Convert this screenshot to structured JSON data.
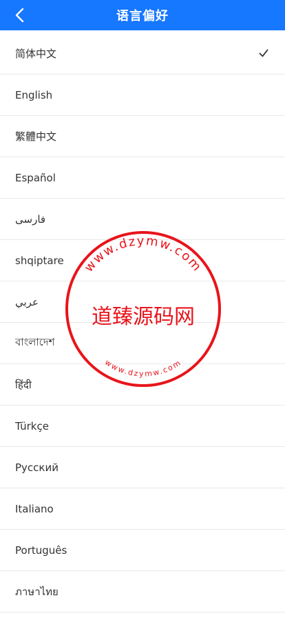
{
  "header": {
    "title": "语言偏好",
    "back_icon": "chevron-left-icon",
    "background": "#1677ff"
  },
  "languages": [
    {
      "label": "简体中文",
      "selected": true
    },
    {
      "label": "English",
      "selected": false
    },
    {
      "label": "繁體中文",
      "selected": false
    },
    {
      "label": "Español",
      "selected": false
    },
    {
      "label": "فارسی",
      "selected": false
    },
    {
      "label": "shqiptare",
      "selected": false
    },
    {
      "label": "عربي",
      "selected": false
    },
    {
      "label": "বাংলাদেশ",
      "selected": false
    },
    {
      "label": "हिंदी",
      "selected": false
    },
    {
      "label": "Türkçe",
      "selected": false
    },
    {
      "label": "Русский",
      "selected": false
    },
    {
      "label": "Italiano",
      "selected": false
    },
    {
      "label": "Português",
      "selected": false
    },
    {
      "label": "ภาษาไทย",
      "selected": false
    }
  ],
  "watermark": {
    "main_text": "道臻源码网",
    "outer_ring_text": "www.dzymw.com",
    "inner_ring_text": "www.dzymw.com",
    "color": "#e8141b"
  }
}
